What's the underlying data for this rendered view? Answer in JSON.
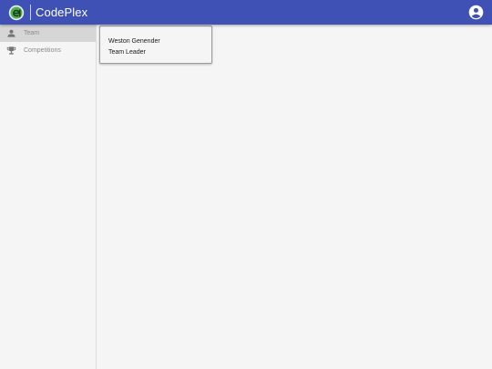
{
  "app": {
    "name": "CodePlex",
    "logo_text": "e",
    "colors": {
      "appbar": "#3f51b5",
      "logo_green": "#4caf50",
      "active_nav": "#d6d6d6"
    }
  },
  "header": {
    "logo_icon": "codeplex-logo-icon",
    "account_icon": "account-circle-icon"
  },
  "sidebar": {
    "items": [
      {
        "label": "Team",
        "icon": "person-icon",
        "active": true
      },
      {
        "label": "Competitions",
        "icon": "trophy-icon",
        "active": false
      }
    ]
  },
  "member_card": {
    "name": "Weston Genender",
    "role": "Team Leader"
  }
}
